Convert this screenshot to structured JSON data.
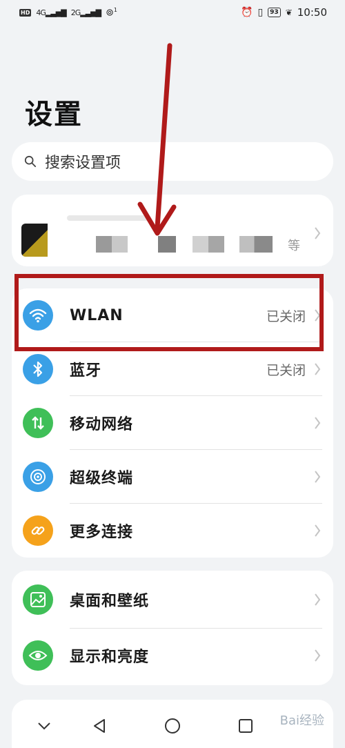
{
  "status_bar": {
    "hd": "HD",
    "signal1": "4G",
    "signal2": "2G",
    "wifi_count": "1",
    "battery": "93",
    "time": "10:50"
  },
  "page": {
    "title": "设置"
  },
  "search": {
    "placeholder": "搜索设置项"
  },
  "account": {
    "suffix": "等"
  },
  "connectivity": [
    {
      "label": "WLAN",
      "status": "已关闭",
      "icon": "wifi-icon",
      "color": "#3aa0e6"
    },
    {
      "label": "蓝牙",
      "status": "已关闭",
      "icon": "bluetooth-icon",
      "color": "#3aa0e6"
    },
    {
      "label": "移动网络",
      "status": "",
      "icon": "mobile-data-icon",
      "color": "#3fbf58"
    },
    {
      "label": "超级终端",
      "status": "",
      "icon": "super-device-icon",
      "color": "#3aa0e6"
    },
    {
      "label": "更多连接",
      "status": "",
      "icon": "link-icon",
      "color": "#f5a21b"
    }
  ],
  "display_group": [
    {
      "label": "桌面和壁纸",
      "icon": "wallpaper-icon",
      "color": "#3fbf58"
    },
    {
      "label": "显示和亮度",
      "icon": "eye-icon",
      "color": "#3fbf58"
    }
  ],
  "annotation": {
    "arrow_color": "#b01a1a",
    "box_color": "#b01a1a"
  },
  "watermark": "Bai经验"
}
